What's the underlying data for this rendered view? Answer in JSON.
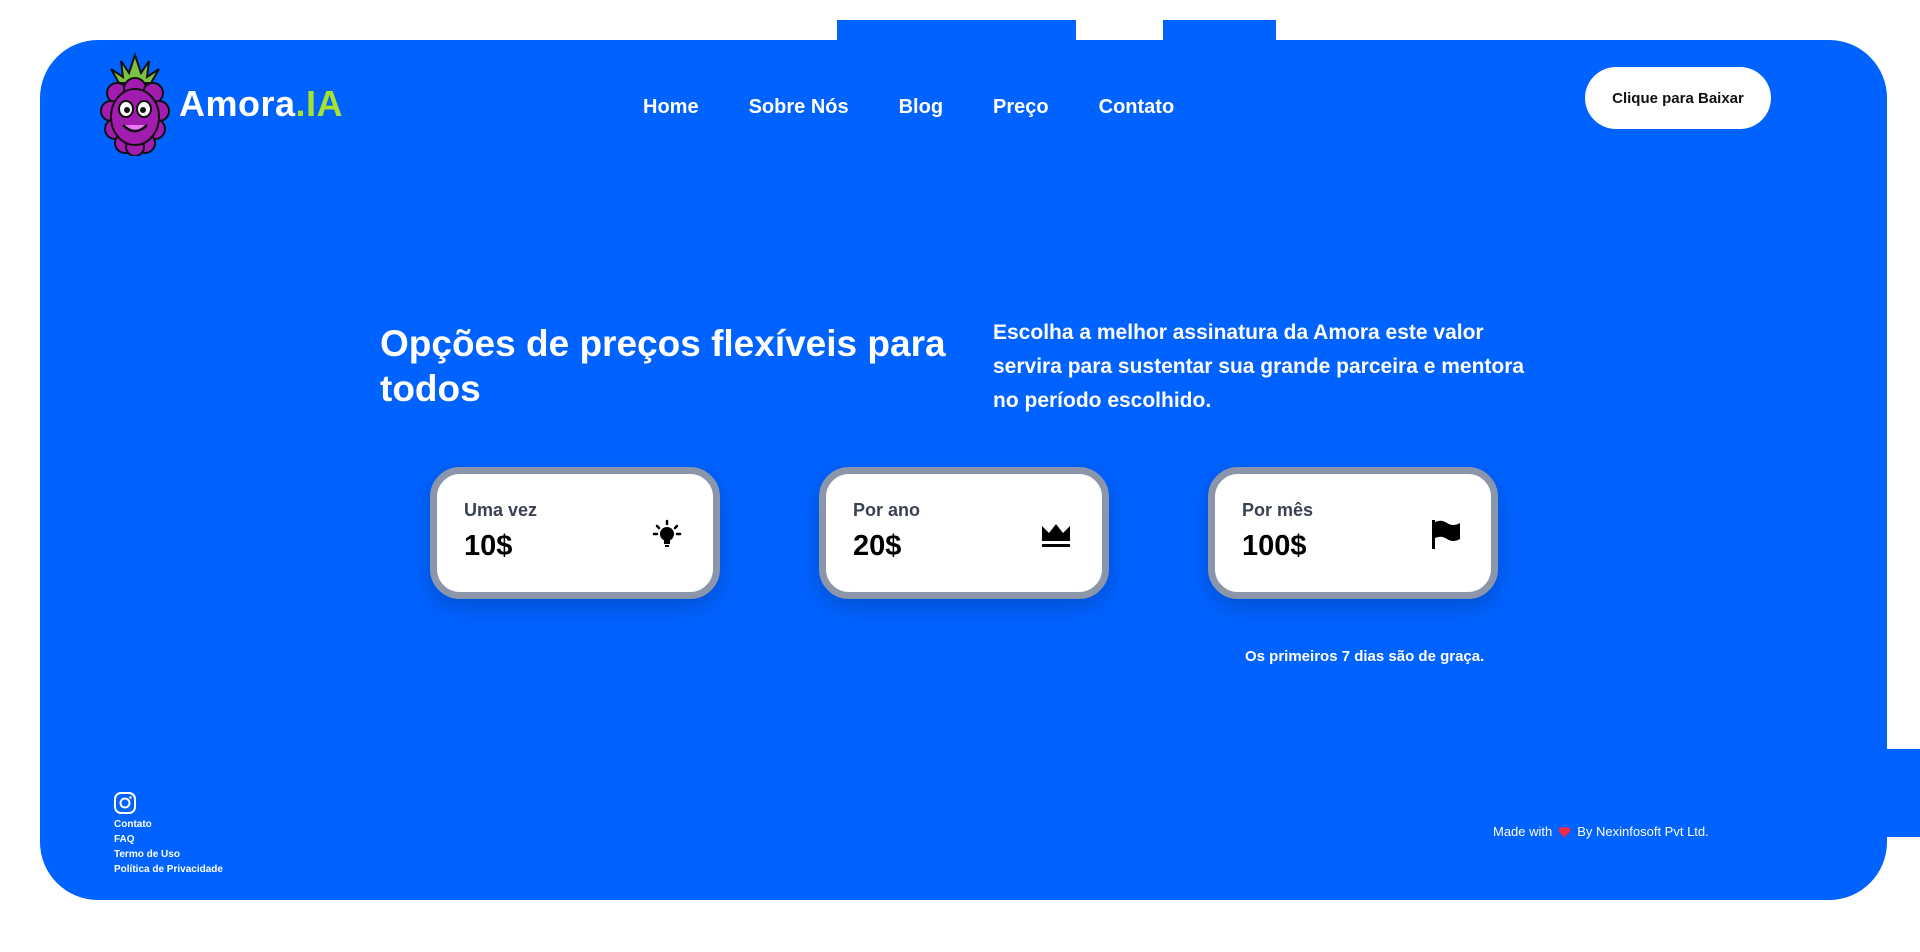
{
  "brand": {
    "name_main": "Amora",
    "name_accent": ".IA",
    "accent_color": "#a6e22e",
    "logo_icon": "raspberry-mascot-icon"
  },
  "colors": {
    "primary": "#0062ff",
    "card_border": "#8b96aa"
  },
  "nav": [
    {
      "label": "Home"
    },
    {
      "label": "Sobre Nós"
    },
    {
      "label": "Blog"
    },
    {
      "label": "Preço"
    },
    {
      "label": "Contato"
    }
  ],
  "cta": {
    "label": "Clique para Baixar"
  },
  "hero": {
    "headline": "Opções de preços flexíveis para todos",
    "subtext": "Escolha a melhor assinatura da Amora este valor servira para sustentar sua grande parceira e mentora no período escolhido."
  },
  "plans": [
    {
      "label": "Uma vez",
      "price": "10$",
      "icon": "lightbulb-icon"
    },
    {
      "label": "Por ano",
      "price": "20$",
      "icon": "crown-icon"
    },
    {
      "label": "Por mês",
      "price": "100$",
      "icon": "flag-icon"
    }
  ],
  "trial_note": "Os primeiros 7 dias são de graça.",
  "footer": {
    "social_icon": "instagram-icon",
    "links": [
      "Contato",
      "FAQ",
      "Termo de Uso",
      "Política de Privacidade"
    ],
    "made_prefix": "Made with",
    "made_suffix": "By Nexinfosoft Pvt Ltd."
  }
}
